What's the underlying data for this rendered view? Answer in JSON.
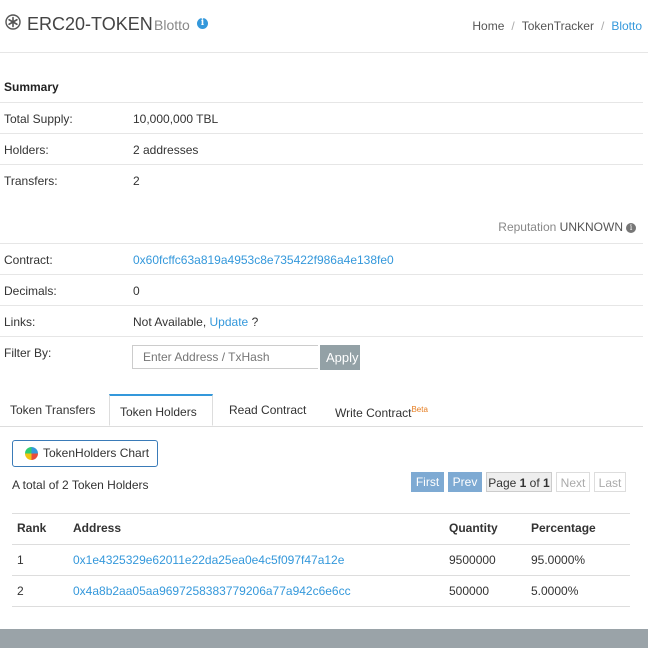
{
  "header": {
    "title": "ERC20-TOKEN",
    "subtitle": "Blotto",
    "breadcrumb": [
      "Home",
      "TokenTracker",
      "Blotto"
    ]
  },
  "summary": {
    "title": "Summary",
    "total_supply_label": "Total Supply:",
    "total_supply_value": "10,000,000 TBL",
    "holders_label": "Holders:",
    "holders_value": "2 addresses",
    "transfers_label": "Transfers:",
    "transfers_value": "2"
  },
  "reputation": {
    "label": "Reputation",
    "value": "UNKNOWN"
  },
  "details": {
    "contract_label": "Contract:",
    "contract_value": "0x60fcffc63a819a4953c8e735422f986a4e138fe0",
    "decimals_label": "Decimals:",
    "decimals_value": "0",
    "links_label": "Links:",
    "links_value": "Not Available,",
    "links_update": "Update",
    "links_q": "?",
    "filter_label": "Filter By:",
    "filter_placeholder": "Enter Address / TxHash",
    "filter_button": "Apply"
  },
  "tabs": [
    {
      "label": "Token Transfers"
    },
    {
      "label": "Token Holders",
      "active": true
    },
    {
      "label": "Read Contract"
    },
    {
      "label": "Write Contract",
      "badge": "Beta"
    }
  ],
  "holders": {
    "chart_button": "TokenHolders Chart",
    "total_text": "A total of 2 Token Holders",
    "pager": {
      "first": "First",
      "prev": "Prev",
      "page_prefix": "Page",
      "page": "1",
      "of": "of",
      "total": "1",
      "next": "Next",
      "last": "Last"
    },
    "columns": [
      "Rank",
      "Address",
      "Quantity",
      "Percentage"
    ],
    "rows": [
      {
        "rank": "1",
        "address": "0x1e4325329e62011e22da25ea0e4c5f097f47a12e",
        "quantity": "9500000",
        "percentage": "95.0000%"
      },
      {
        "rank": "2",
        "address": "0x4a8b2aa05aa9697258383779206a77a942c6e6cc",
        "quantity": "500000",
        "percentage": "5.0000%"
      }
    ]
  }
}
